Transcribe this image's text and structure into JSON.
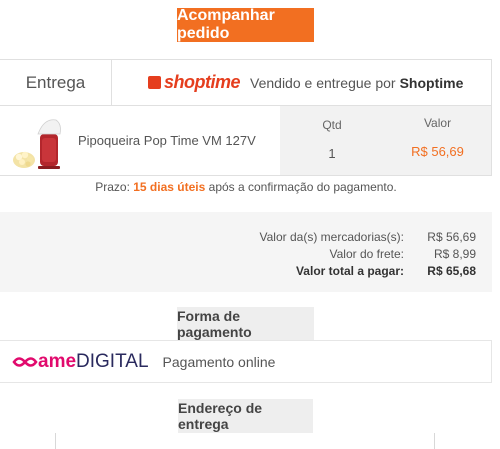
{
  "header": {
    "track_button": "Acompanhar pedido"
  },
  "delivery": {
    "section_label": "Entrega",
    "logo_text": "shoptime",
    "seller_prefix": "Vendido e entregue por",
    "seller_name": "Shoptime"
  },
  "product": {
    "name": "Pipoqueira Pop Time VM 127V",
    "qty_label": "Qtd",
    "qty": "1",
    "value_label": "Valor",
    "value": "R$ 56,69"
  },
  "prazo": {
    "prefix": "Prazo:",
    "highlight": "15 dias úteis",
    "suffix": "após a confirmação do pagamento."
  },
  "totals": [
    {
      "label": "Valor da(s) mercadorias(s):",
      "amount": "R$ 56,69"
    },
    {
      "label": "Valor do frete:",
      "amount": "R$ 8,99"
    },
    {
      "label": "Valor total a pagar:",
      "amount": "R$ 65,68"
    }
  ],
  "payment": {
    "heading": "Forma de pagamento",
    "logo_ame": "ame",
    "logo_digital": "DIGITAL",
    "method": "Pagamento online"
  },
  "address": {
    "heading": "Endereço de entrega"
  },
  "colors": {
    "accent": "#f26f21",
    "shoptime": "#e53e1e",
    "ame": "#e10a6d"
  }
}
